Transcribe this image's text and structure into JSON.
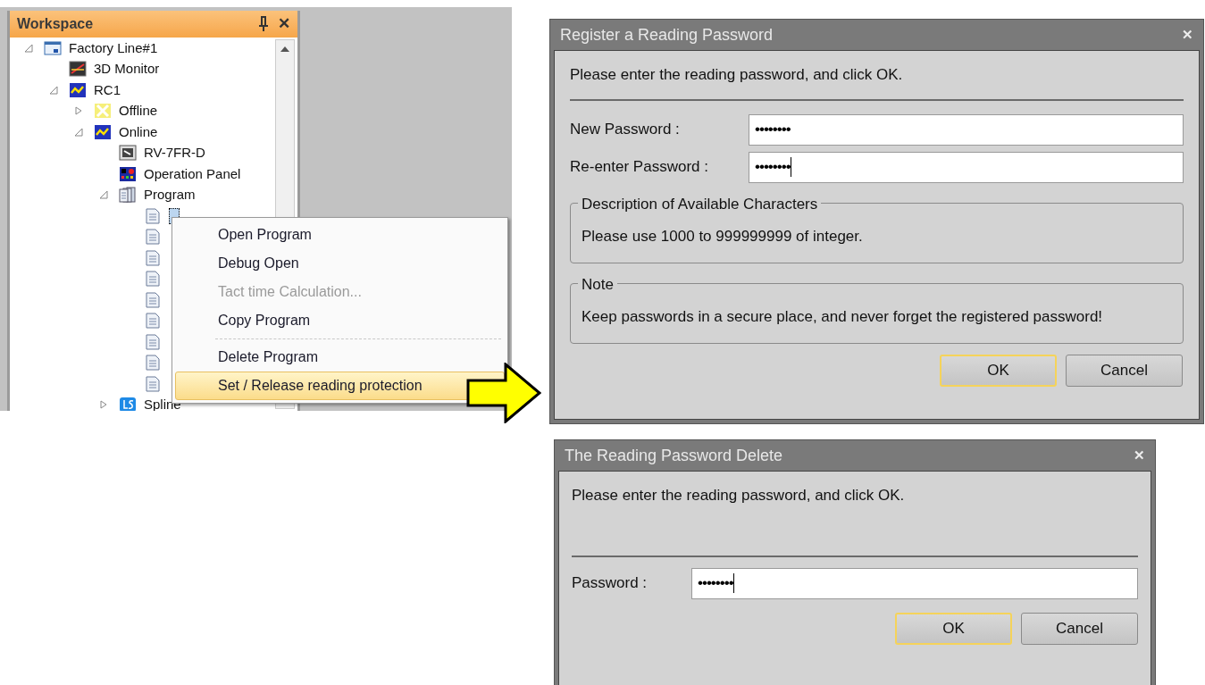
{
  "workspace": {
    "title": "Workspace",
    "close": "✕",
    "tree": [
      {
        "label": "Factory Line#1",
        "kind": "window",
        "expanded": true,
        "children": [
          {
            "label": "3D Monitor",
            "kind": "monitor"
          },
          {
            "label": "RC1",
            "kind": "controller",
            "expanded": true,
            "children": [
              {
                "label": "Offline",
                "kind": "offline",
                "expanded": false
              },
              {
                "label": "Online",
                "kind": "controller",
                "expanded": true,
                "children": [
                  {
                    "label": "RV-7FR-D",
                    "kind": "robot"
                  },
                  {
                    "label": "Operation Panel",
                    "kind": "panel"
                  },
                  {
                    "label": "Program",
                    "kind": "program",
                    "expanded": true,
                    "children": [
                      {
                        "kind": "file",
                        "selected": true
                      },
                      {
                        "kind": "file",
                        "selected": false
                      },
                      {
                        "kind": "file",
                        "selected": false
                      },
                      {
                        "kind": "file",
                        "selected": false
                      },
                      {
                        "kind": "file",
                        "selected": false
                      },
                      {
                        "kind": "file",
                        "selected": false
                      },
                      {
                        "kind": "file",
                        "selected": false
                      },
                      {
                        "kind": "file",
                        "selected": false
                      },
                      {
                        "kind": "file",
                        "selected": false
                      }
                    ]
                  },
                  {
                    "label": "Spline",
                    "kind": "spline",
                    "expanded": false
                  }
                ]
              }
            ]
          }
        ]
      }
    ]
  },
  "context_menu": [
    {
      "kind": "item",
      "label": "Open Program",
      "disabled": false,
      "selected": false
    },
    {
      "kind": "item",
      "label": "Debug Open",
      "disabled": false,
      "selected": false
    },
    {
      "kind": "item",
      "label": "Tact time Calculation...",
      "disabled": true,
      "selected": false
    },
    {
      "kind": "item",
      "label": "Copy Program",
      "disabled": false,
      "selected": false
    },
    {
      "kind": "separator"
    },
    {
      "kind": "item",
      "label": "Delete Program",
      "disabled": false,
      "selected": false
    },
    {
      "kind": "item",
      "label": "Set / Release reading protection",
      "disabled": false,
      "selected": true
    }
  ],
  "register_dialog": {
    "title": "Register a Reading Password",
    "close": "✕",
    "message": "Please enter the reading password, and click OK.",
    "fields": [
      {
        "label": "New Password :",
        "value": "••••••••",
        "focused": false
      },
      {
        "label": "Re-enter Password :",
        "value": "••••••••",
        "focused": true
      }
    ],
    "groups": [
      {
        "title": "Description of Available Characters",
        "text": "Please use 1000 to 999999999 of integer."
      },
      {
        "title": "Note",
        "text": "Keep passwords in a secure place, and never forget the registered password!"
      }
    ],
    "buttons": [
      {
        "label": "OK",
        "focused": true
      },
      {
        "label": "Cancel",
        "focused": false
      }
    ]
  },
  "delete_dialog": {
    "title": "The Reading Password Delete",
    "close": "✕",
    "message": "Please enter the reading password, and click OK.",
    "fields": [
      {
        "label": "Password :",
        "value": "••••••••",
        "focused": true
      }
    ],
    "buttons": [
      {
        "label": "OK",
        "focused": true
      },
      {
        "label": "Cancel",
        "focused": false
      }
    ]
  }
}
